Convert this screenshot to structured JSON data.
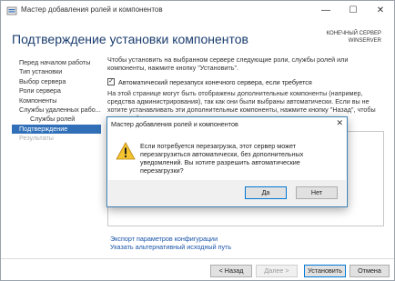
{
  "window": {
    "title": "Мастер добавления ролей и компонентов",
    "minimize_glyph": "—",
    "maximize_glyph": "☐",
    "close_glyph": "✕"
  },
  "header": {
    "title": "Подтверждение установки компонентов",
    "server_caption": "КОНЕЧНЫЙ СЕРВЕР",
    "server_name": "WINSERVER"
  },
  "nav": {
    "items": [
      {
        "label": "Перед началом работы",
        "state": "normal"
      },
      {
        "label": "Тип установки",
        "state": "normal"
      },
      {
        "label": "Выбор сервера",
        "state": "normal"
      },
      {
        "label": "Роли сервера",
        "state": "normal"
      },
      {
        "label": "Компоненты",
        "state": "normal"
      },
      {
        "label": "Службы удаленных рабо...",
        "state": "normal"
      },
      {
        "label": "Службы ролей",
        "state": "sub"
      },
      {
        "label": "Подтверждение",
        "state": "active"
      },
      {
        "label": "Результаты",
        "state": "disabled"
      }
    ]
  },
  "content": {
    "intro": "Чтобы установить на выбранном сервере следующие роли, службы ролей или компоненты, нажмите кнопку \"Установить\".",
    "restart_checkbox_label": "Автоматический перезапуск конечного сервера, если требуется",
    "restart_checked_glyph": "✓",
    "info": "На этой странице могут быть отображены дополнительные компоненты (например, средства администрирования), так как они были выбраны автоматически. Если вы не хотите устанавливать эти дополнительные компоненты, нажмите кнопку \"Назад\", чтобы снять их флажки."
  },
  "links": {
    "export": "Экспорт параметров конфигурации",
    "alt_source": "Указать альтернативный исходный путь"
  },
  "footer": {
    "back": "< Назад",
    "next": "Далее >",
    "install": "Установить",
    "cancel": "Отмена"
  },
  "dialog": {
    "title": "Мастер добавления ролей и компонентов",
    "close_glyph": "✕",
    "icon": "warning-icon",
    "message": "Если потребуется перезагрузка, этот сервер может перезагрузиться автоматически, без дополнительных уведомлений. Вы хотите разрешить автоматические перезагрузки?",
    "yes": "Да",
    "no": "Нет"
  },
  "colors": {
    "accent": "#3170b8",
    "title": "#1a3c6e",
    "link": "#1a55a8",
    "warning": "#f4c430"
  }
}
